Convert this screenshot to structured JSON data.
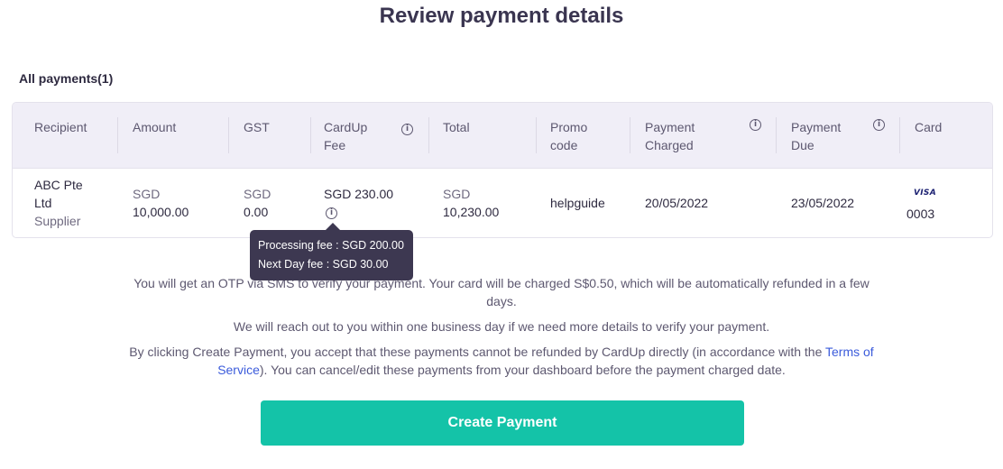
{
  "page": {
    "title": "Review payment details"
  },
  "section": {
    "label": "All payments(1)"
  },
  "table": {
    "headers": {
      "recipient": "Recipient",
      "amount": "Amount",
      "gst": "GST",
      "cardup_fee": "CardUp Fee",
      "total": "Total",
      "promo_code": "Promo code",
      "payment_charged": "Payment Charged",
      "payment_due": "Payment Due",
      "card": "Card"
    },
    "row": {
      "recipient_name": "ABC Pte Ltd",
      "recipient_type": "Supplier",
      "amount_currency": "SGD",
      "amount_value": "10,000.00",
      "gst_currency": "SGD",
      "gst_value": "0.00",
      "fee": "SGD 230.00",
      "total_currency": "SGD",
      "total_value": "10,230.00",
      "promo_code": "helpguide",
      "payment_charged": "20/05/2022",
      "payment_due": "23/05/2022",
      "card_brand": "VISA",
      "card_last4": "0003"
    }
  },
  "tooltip": {
    "processing_fee": "Processing fee : SGD 200.00",
    "next_day_fee": "Next Day fee : SGD 30.00"
  },
  "notes": {
    "otp": "You will get an OTP via SMS to verify your payment. Your card will be charged S$0.50, which will be automatically refunded in a few days.",
    "reach_out": "We will reach out to you within one business day if we need more details to verify your payment.",
    "terms_before": "By clicking Create Payment, you accept that these payments cannot be refunded by CardUp directly (in accordance with the ",
    "terms_link": "Terms of Service",
    "terms_after": "). You can cancel/edit these payments from your dashboard before the payment charged date."
  },
  "actions": {
    "create_payment": "Create Payment"
  },
  "colors": {
    "primary_button": "#14c3a8",
    "link": "#3b5bdb",
    "tooltip_bg": "#3d3851",
    "header_bg": "#f0eef7"
  }
}
